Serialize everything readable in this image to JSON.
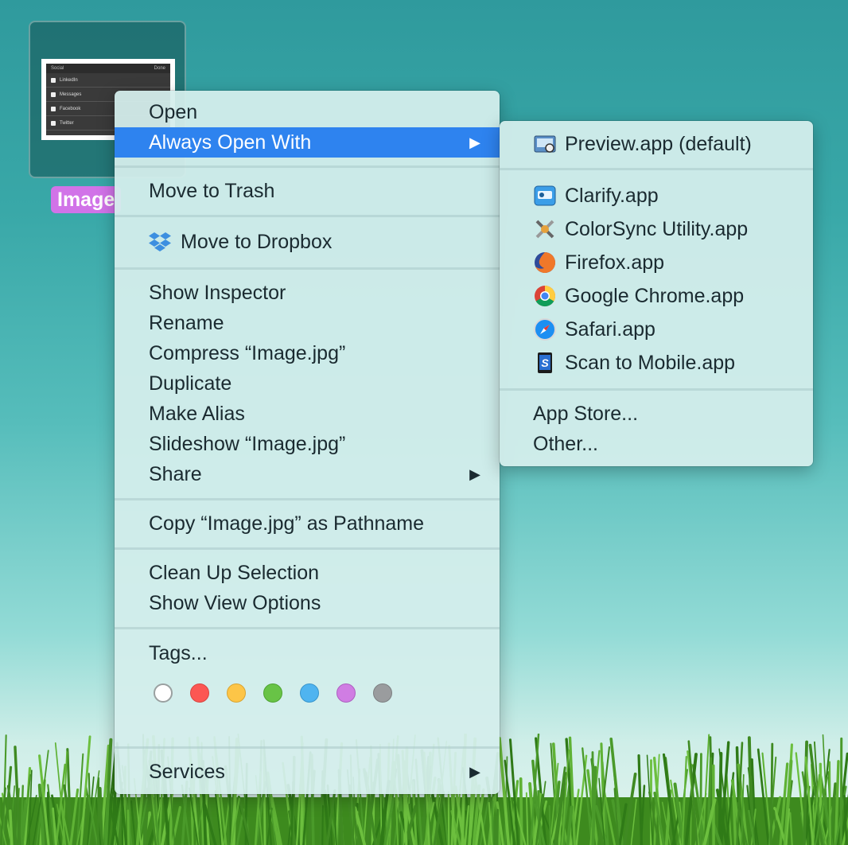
{
  "desktop": {
    "file_label": "Image",
    "thumbnail": {
      "header_left": "Social",
      "header_right": "Done",
      "rows": [
        "LinkedIn",
        "Messages",
        "Facebook",
        "Twitter"
      ]
    }
  },
  "context_menu": {
    "open": "Open",
    "always_open_with": "Always Open With",
    "move_to_trash": "Move to Trash",
    "move_to_dropbox": "Move to Dropbox",
    "show_inspector": "Show Inspector",
    "rename": "Rename",
    "compress": "Compress “Image.jpg”",
    "duplicate": "Duplicate",
    "make_alias": "Make Alias",
    "slideshow": "Slideshow “Image.jpg”",
    "share": "Share",
    "copy_pathname": "Copy “Image.jpg” as Pathname",
    "clean_up": "Clean Up Selection",
    "show_view_options": "Show View Options",
    "tags": "Tags...",
    "services": "Services",
    "arrow_glyph": "▶"
  },
  "tag_colors": [
    {
      "name": "none",
      "color": "#ffffff"
    },
    {
      "name": "red",
      "color": "#fc5753"
    },
    {
      "name": "orange",
      "color": "#fdc547"
    },
    {
      "name": "green",
      "color": "#68c346"
    },
    {
      "name": "blue",
      "color": "#4fb4f0"
    },
    {
      "name": "purple",
      "color": "#d07de3"
    },
    {
      "name": "gray",
      "color": "#9a9c9e"
    }
  ],
  "submenu": {
    "default_app": "Preview.app (default)",
    "apps": [
      {
        "label": "Clarify.app",
        "icon": "clarify-icon"
      },
      {
        "label": "ColorSync Utility.app",
        "icon": "colorsync-icon"
      },
      {
        "label": "Firefox.app",
        "icon": "firefox-icon"
      },
      {
        "label": "Google Chrome.app",
        "icon": "chrome-icon"
      },
      {
        "label": "Safari.app",
        "icon": "safari-icon"
      },
      {
        "label": "Scan to Mobile.app",
        "icon": "scan-to-mobile-icon"
      }
    ],
    "app_store": "App Store...",
    "other": "Other..."
  },
  "colors": {
    "selection": "#2e83ef",
    "label_bg": "#d173e8"
  }
}
